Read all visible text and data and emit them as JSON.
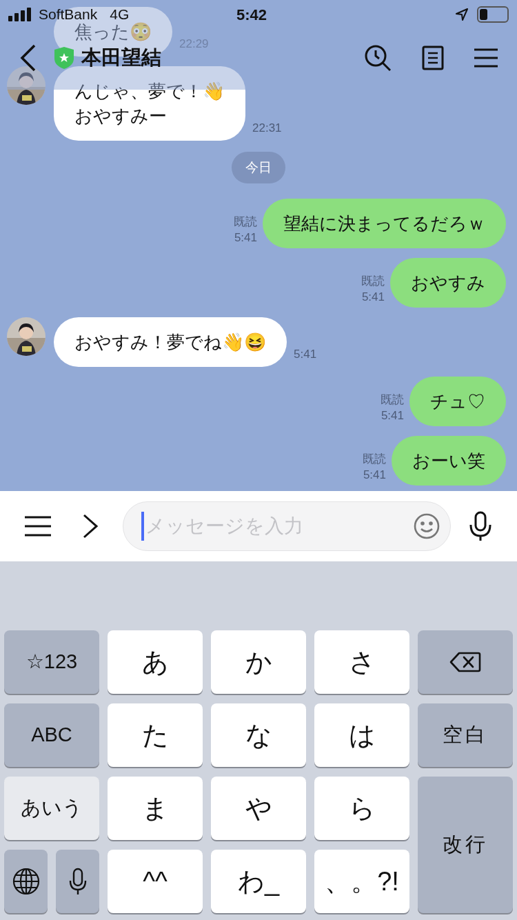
{
  "status_bar": {
    "carrier": "SoftBank",
    "network": "4G",
    "time": "5:42"
  },
  "header": {
    "title": "本田望結"
  },
  "messages": [
    {
      "kind": "incoming",
      "text": "焦った😳",
      "time": "22:29",
      "avatar": false
    },
    {
      "kind": "incoming",
      "text": "んじゃ、夢で！👋\nおやすみー",
      "time": "22:31",
      "avatar": true
    },
    {
      "kind": "date",
      "text": "今日"
    },
    {
      "kind": "outgoing",
      "text": "望結に決まってるだろｗ",
      "read": "既読",
      "time": "5:41"
    },
    {
      "kind": "outgoing",
      "text": "おやすみ",
      "read": "既読",
      "time": "5:41"
    },
    {
      "kind": "incoming",
      "text": "おやすみ！夢でね👋😆",
      "time": "5:41",
      "avatar": true
    },
    {
      "kind": "outgoing",
      "text": "チュ♡",
      "read": "既読",
      "time": "5:41"
    },
    {
      "kind": "outgoing",
      "text": "おーい笑",
      "read": "既読",
      "time": "5:41"
    }
  ],
  "input": {
    "placeholder": "メッセージを入力"
  },
  "keyboard": [
    {
      "kind": "mode",
      "label": "☆123",
      "selected": false
    },
    {
      "kind": "char",
      "label": "あ"
    },
    {
      "kind": "char",
      "label": "か"
    },
    {
      "kind": "char",
      "label": "さ"
    },
    {
      "kind": "backspace"
    },
    {
      "kind": "mode",
      "label": "ABC",
      "selected": false
    },
    {
      "kind": "char",
      "label": "た"
    },
    {
      "kind": "char",
      "label": "な"
    },
    {
      "kind": "char",
      "label": "は"
    },
    {
      "kind": "function",
      "label": "空白"
    },
    {
      "kind": "mode",
      "label": "あいう",
      "selected": true
    },
    {
      "kind": "char",
      "label": "ま"
    },
    {
      "kind": "char",
      "label": "や"
    },
    {
      "kind": "char",
      "label": "ら"
    },
    {
      "kind": "enter",
      "label": "改行"
    },
    {
      "kind": "pair",
      "keys": [
        {
          "kind": "globe"
        },
        {
          "kind": "mic"
        }
      ]
    },
    {
      "kind": "char",
      "label": "^^"
    },
    {
      "kind": "char",
      "label": "わ_"
    },
    {
      "kind": "char",
      "label": "、。?!"
    }
  ]
}
